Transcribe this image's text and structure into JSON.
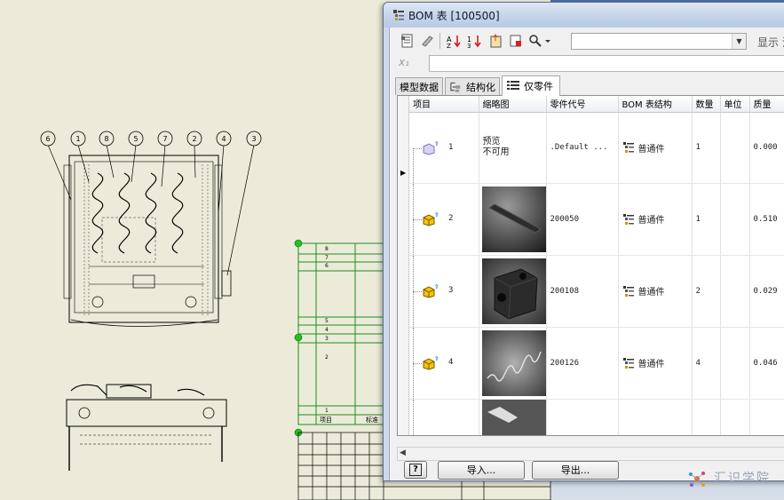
{
  "cad": {
    "balloons": [
      "6",
      "1",
      "8",
      "5",
      "7",
      "2",
      "4",
      "3"
    ],
    "parts_list_rows": [
      "8",
      "7",
      "6",
      "5",
      "4",
      "3",
      "2",
      "1"
    ],
    "parts_list_header": [
      "项目",
      "标准"
    ]
  },
  "dialog": {
    "title": "BOM 表 [100500]",
    "toolbar": {
      "display_label": "显示 法"
    },
    "formula_icon": "x₁",
    "tabs": [
      {
        "label": "模型数据"
      },
      {
        "label": "结构化"
      },
      {
        "label": "仅零件"
      }
    ],
    "active_tab": "仅零件",
    "columns": [
      "项目",
      "缩略图",
      "零件代号",
      "BOM 表结构",
      "数量",
      "单位",
      "质量"
    ],
    "rows": [
      {
        "item": "1",
        "thumbnail": "预览 不可用",
        "thumbnail_lines": [
          "预览",
          "不可用"
        ],
        "part_number": ".Default ...",
        "bom_structure": "普通件",
        "quantity": "1",
        "unit": "",
        "mass": "0.000"
      },
      {
        "item": "2",
        "thumbnail": "flat-bar",
        "part_number": "200050",
        "bom_structure": "普通件",
        "quantity": "1",
        "unit": "",
        "mass": "0.510"
      },
      {
        "item": "3",
        "thumbnail": "cube-block",
        "part_number": "200108",
        "bom_structure": "普通件",
        "quantity": "2",
        "unit": "",
        "mass": "0.029"
      },
      {
        "item": "4",
        "thumbnail": "wire-spring",
        "part_number": "200126",
        "bom_structure": "普通件",
        "quantity": "4",
        "unit": "",
        "mass": "0.046"
      }
    ],
    "buttons": {
      "help": "?",
      "import": "导入...",
      "export": "导出..."
    }
  },
  "watermark": "汇识学院",
  "colors": {
    "cad_background": "#ecebd9",
    "cad_table_line": "#1a8f1a",
    "dialog_frame": "#cdd9ea"
  }
}
